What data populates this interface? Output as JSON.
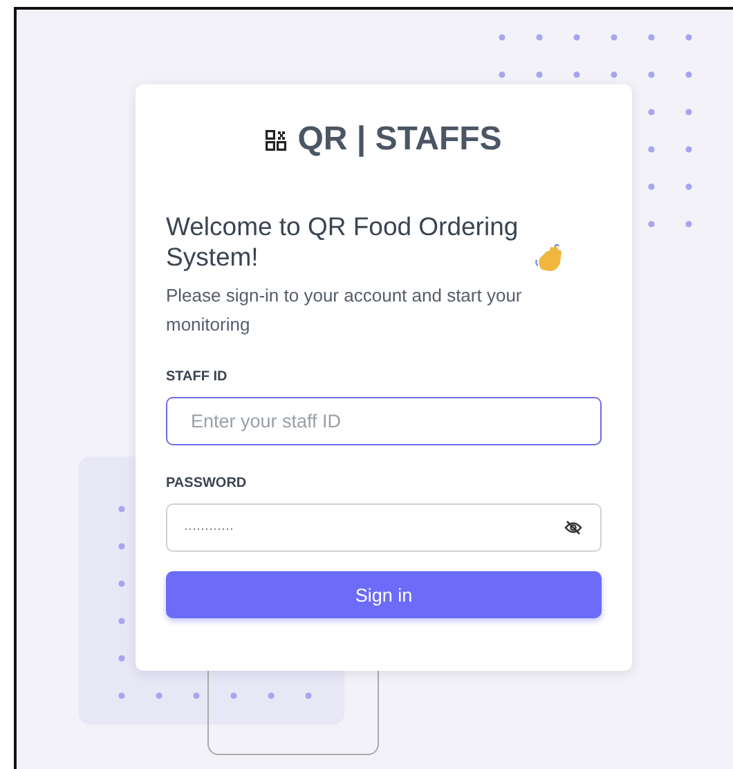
{
  "brand": {
    "title": "QR | STAFFS"
  },
  "welcome": {
    "heading": "Welcome to QR Food Ordering System!",
    "subtitle": "Please sign-in to your account and start your monitoring"
  },
  "fields": [
    {
      "kind": "text",
      "label": "STAFF ID",
      "placeholder": "Enter your staff ID",
      "focused": true
    },
    {
      "kind": "password",
      "label": "PASSWORD",
      "value": "············",
      "focused": false
    }
  ],
  "buttons": [
    "Sign in"
  ]
}
